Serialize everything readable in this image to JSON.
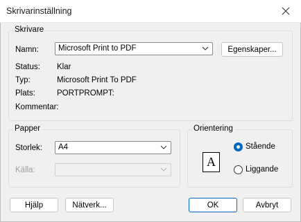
{
  "window": {
    "title": "Skrivarinställning"
  },
  "printer_group": {
    "legend": "Skrivare",
    "name_label": "Namn:",
    "name_value": "Microsoft Print to PDF",
    "properties_button": "Egenskaper...",
    "status_label": "Status:",
    "status_value": "Klar",
    "type_label": "Typ:",
    "type_value": "Microsoft Print To PDF",
    "where_label": "Plats:",
    "where_value": "PORTPROMPT:",
    "comment_label": "Kommentar:",
    "comment_value": ""
  },
  "paper_group": {
    "legend": "Papper",
    "size_label": "Storlek:",
    "size_value": "A4",
    "source_label": "Källa:",
    "source_value": ""
  },
  "orientation_group": {
    "legend": "Orientering",
    "icon_letter": "A",
    "portrait_label": "Stående",
    "landscape_label": "Liggande",
    "selected": "portrait"
  },
  "buttons": {
    "help": "Hjälp",
    "network": "Nätverk...",
    "ok": "OK",
    "cancel": "Avbryt"
  },
  "colors": {
    "accent": "#0067c0",
    "background": "#f0f0f0"
  }
}
